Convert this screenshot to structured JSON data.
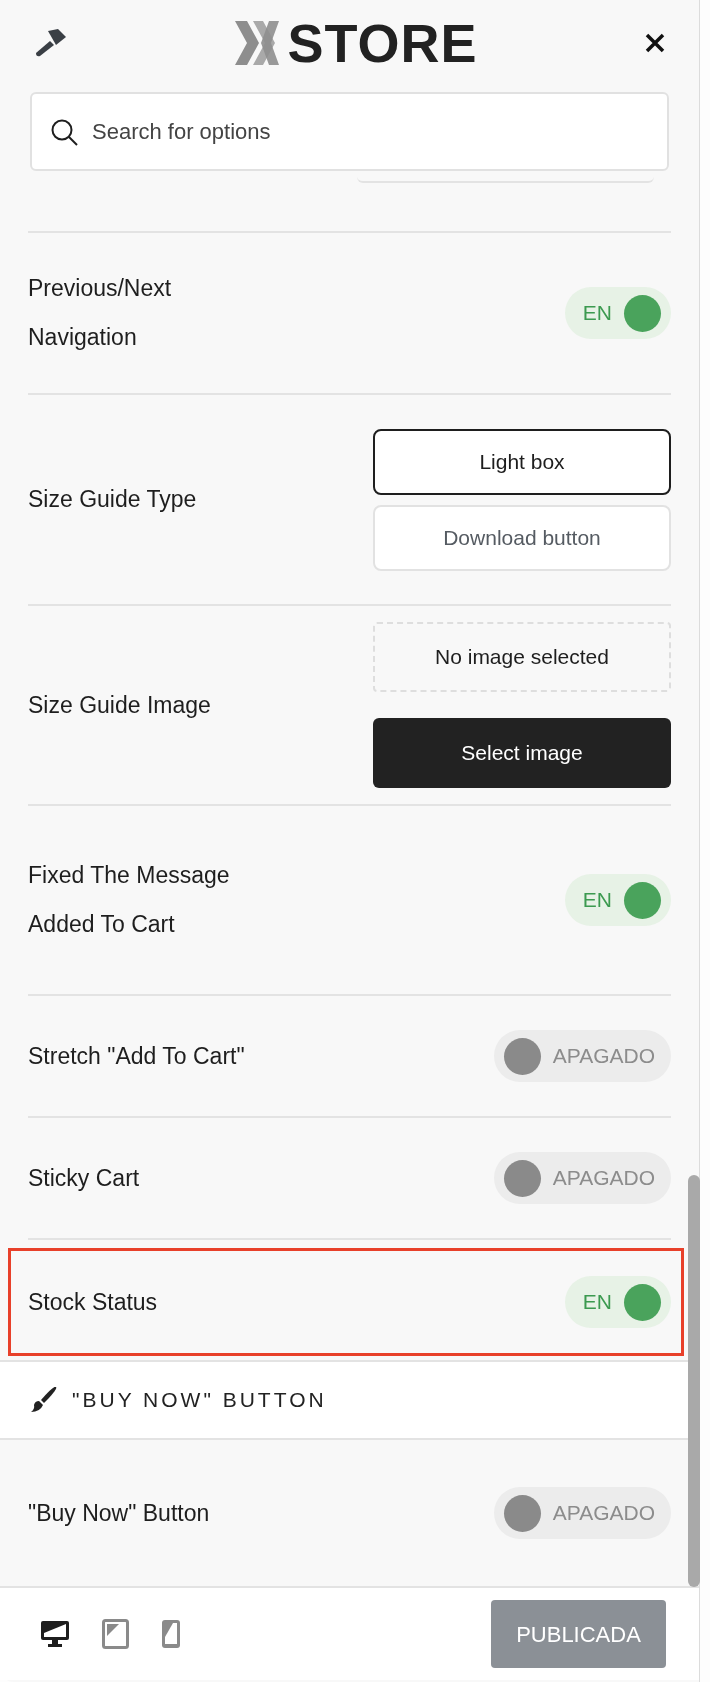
{
  "header": {
    "logo": "STORE",
    "search": {
      "placeholder": "Search for options"
    }
  },
  "settings": [
    {
      "kind": "toggle",
      "label": "Previous/Next Navigation",
      "on": true,
      "state_text": "EN",
      "highlighted": false
    },
    {
      "kind": "choice",
      "label": "Size Guide Type",
      "options": [
        {
          "label": "Light box",
          "selected": true
        },
        {
          "label": "Download button",
          "selected": false
        }
      ]
    },
    {
      "kind": "image",
      "label": "Size Guide Image",
      "empty_text": "No image selected",
      "button": "Select image"
    },
    {
      "kind": "toggle",
      "label": "Fixed The Message Added To Cart",
      "on": true,
      "state_text": "EN",
      "highlighted": false
    },
    {
      "kind": "toggle",
      "label": "Stretch \"Add To Cart\"",
      "on": false,
      "state_text": "APAGADO",
      "highlighted": false
    },
    {
      "kind": "toggle",
      "label": "Sticky Cart",
      "on": false,
      "state_text": "APAGADO",
      "highlighted": false
    },
    {
      "kind": "toggle",
      "label": "Stock Status",
      "on": true,
      "state_text": "EN",
      "highlighted": true
    }
  ],
  "section": {
    "title": "\"BUY NOW\" BUTTON",
    "settings": [
      {
        "kind": "toggle",
        "label": "\"Buy Now\" Button",
        "on": false,
        "state_text": "APAGADO",
        "highlighted": false
      }
    ]
  },
  "footer": {
    "devices": [
      {
        "kind": "desktop",
        "selected": true
      },
      {
        "kind": "tablet",
        "selected": false
      },
      {
        "kind": "mobile",
        "selected": false
      }
    ],
    "publish": "PUBLICADA"
  }
}
